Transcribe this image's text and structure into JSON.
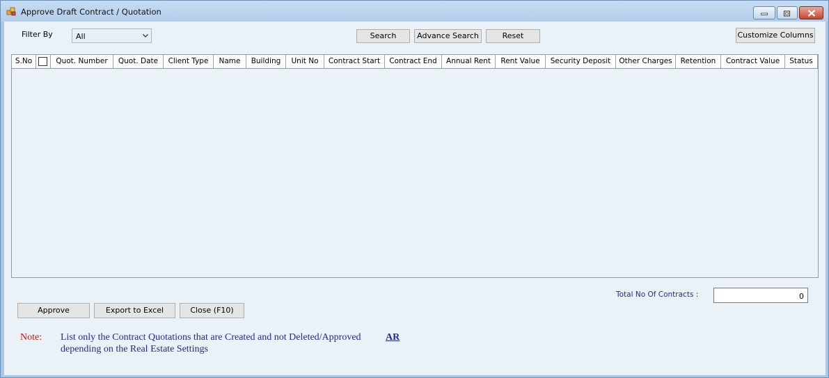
{
  "window": {
    "title": "Approve Draft Contract / Quotation"
  },
  "filter": {
    "label": "Filter By",
    "selected": "All"
  },
  "toolbar": {
    "search_label": "Search",
    "advance_search_label": "Advance Search",
    "reset_label": "Reset",
    "customize_columns_label": "Customize Columns"
  },
  "grid": {
    "columns": [
      "S.No",
      "",
      "Quot. Number",
      "Quot. Date",
      "Client Type",
      "Name",
      "Building",
      "Unit No",
      "Contract Start",
      "Contract End",
      "Annual Rent",
      "Rent Value",
      "Security Deposit",
      "Other Charges",
      "Retention",
      "Contract Value",
      "Status"
    ],
    "rows": []
  },
  "totals": {
    "label": "Total No Of Contracts :",
    "value": "0"
  },
  "actions": {
    "approve_label": "Approve",
    "export_label": "Export to Excel",
    "close_label": "Close (F10)"
  },
  "note": {
    "label": "Note:",
    "line1": "List only the Contract Quotations that are Created and not Deleted/Approved",
    "link": "AR",
    "line2": "depending on the Real Estate Settings"
  },
  "icons": {
    "app": "app-icon",
    "minimize": "minimize-icon",
    "maximize": "restore-icon",
    "close": "close-icon",
    "dropdown": "chevron-down-icon"
  },
  "colors": {
    "note_label": "#cc1111",
    "note_text": "#1d2b9c",
    "client_bg": "#eaf2f8"
  }
}
